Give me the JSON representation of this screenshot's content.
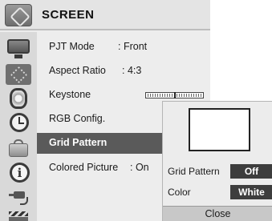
{
  "header": {
    "title": "SCREEN",
    "icon": "screen-settings-icon"
  },
  "sidebar_icons": [
    "monitor-icon",
    "screen-icon",
    "speaker-icon",
    "clock-icon",
    "bag-icon",
    "info-icon",
    "cable-icon",
    "clapperboard-icon"
  ],
  "menu": {
    "pjt_mode": {
      "label": "PJT Mode",
      "value": ": Front"
    },
    "aspect_ratio": {
      "label": "Aspect Ratio",
      "value": ": 4:3"
    },
    "keystone": {
      "label": "Keystone",
      "level": 0.5
    },
    "rgb_config": {
      "label": "RGB Config."
    },
    "grid_pattern": {
      "label": "Grid Pattern",
      "selected": true
    },
    "colored_picture": {
      "label": "Colored Picture",
      "value": ": On"
    }
  },
  "popup": {
    "grid_pattern_label": "Grid Pattern",
    "grid_pattern_value": "Off",
    "color_label": "Color",
    "color_value": "White",
    "preview_color": "#ffffff",
    "close_label": "Close"
  },
  "colors": {
    "selected_bg": "#5a5a5a",
    "value_bg": "#3d3d3d",
    "panel_bg": "#ededed"
  }
}
